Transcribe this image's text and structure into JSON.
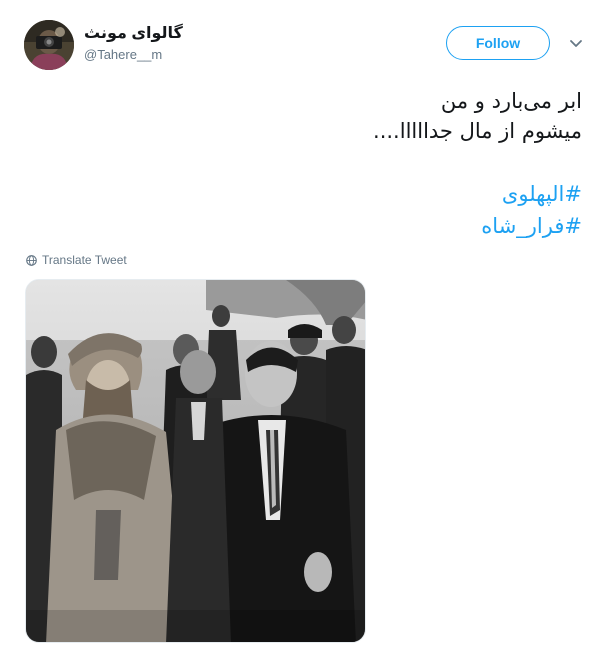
{
  "user": {
    "display_name": "گالوای مونث",
    "handle": "@Tahere__m"
  },
  "actions": {
    "follow_label": "Follow"
  },
  "tweet": {
    "lines": [
      "ابر می‌بارد و من",
      "میشوم از مال جدااااا...."
    ],
    "hashtags": [
      "#الپهلوی",
      "#فرار_شاه"
    ],
    "translate_label": "Translate Tweet"
  },
  "colors": {
    "link": "#1da1f2",
    "secondary_text": "#657786",
    "text": "#14171a"
  },
  "icons": {
    "caret": "chevron-down-icon",
    "translate": "globe-icon"
  }
}
